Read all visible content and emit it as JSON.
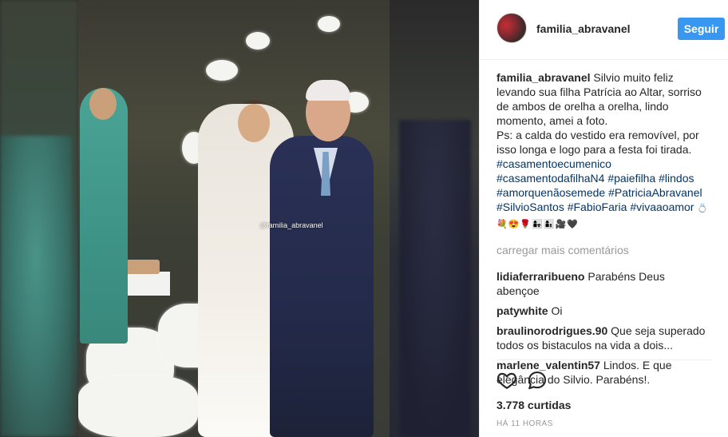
{
  "post": {
    "username": "familia_abravanel",
    "follow_label": "Seguir",
    "watermark": "@familia_abravanel",
    "caption": {
      "author": "familia_abravanel",
      "text": "Silvio muito feliz levando sua filha Patrícia ao Altar, sorriso de ambos de orelha a orelha, lindo momento, amei a foto.",
      "ps": "Ps: a calda do vestido era removível, por isso longa e logo para a festa foi tirada.",
      "tags": [
        "#casamentoecumenico",
        "#casamentodafilhaN4",
        "#paiefilha",
        "#lindos",
        "#amorquenãosemede",
        "#PatriciaAbravanel",
        "#SilvioSantos",
        "#FabioFaria",
        "#vivaaoamor"
      ],
      "emojis_line1": "💍",
      "emojis_line2": "💐😍🌹👩‍👧👩‍👦🎥🖤"
    },
    "load_more": "carregar mais comentários",
    "comments": [
      {
        "user": "lidiaferraribueno",
        "text": "Parabéns Deus abençoe"
      },
      {
        "user": "patywhite",
        "text": "Oi"
      },
      {
        "user": "braulinorodrigues.90",
        "text": "Que seja superado todos os bistaculos na vida a dois..."
      },
      {
        "user": "marlene_valentin57",
        "text": "Lindos. E que elegância do Silvio. Parabéns!."
      }
    ],
    "likes": "3.778 curtidas",
    "time": "HÁ 11 HORAS",
    "icons": {
      "like": "heart-icon",
      "comment": "comment-icon"
    }
  }
}
